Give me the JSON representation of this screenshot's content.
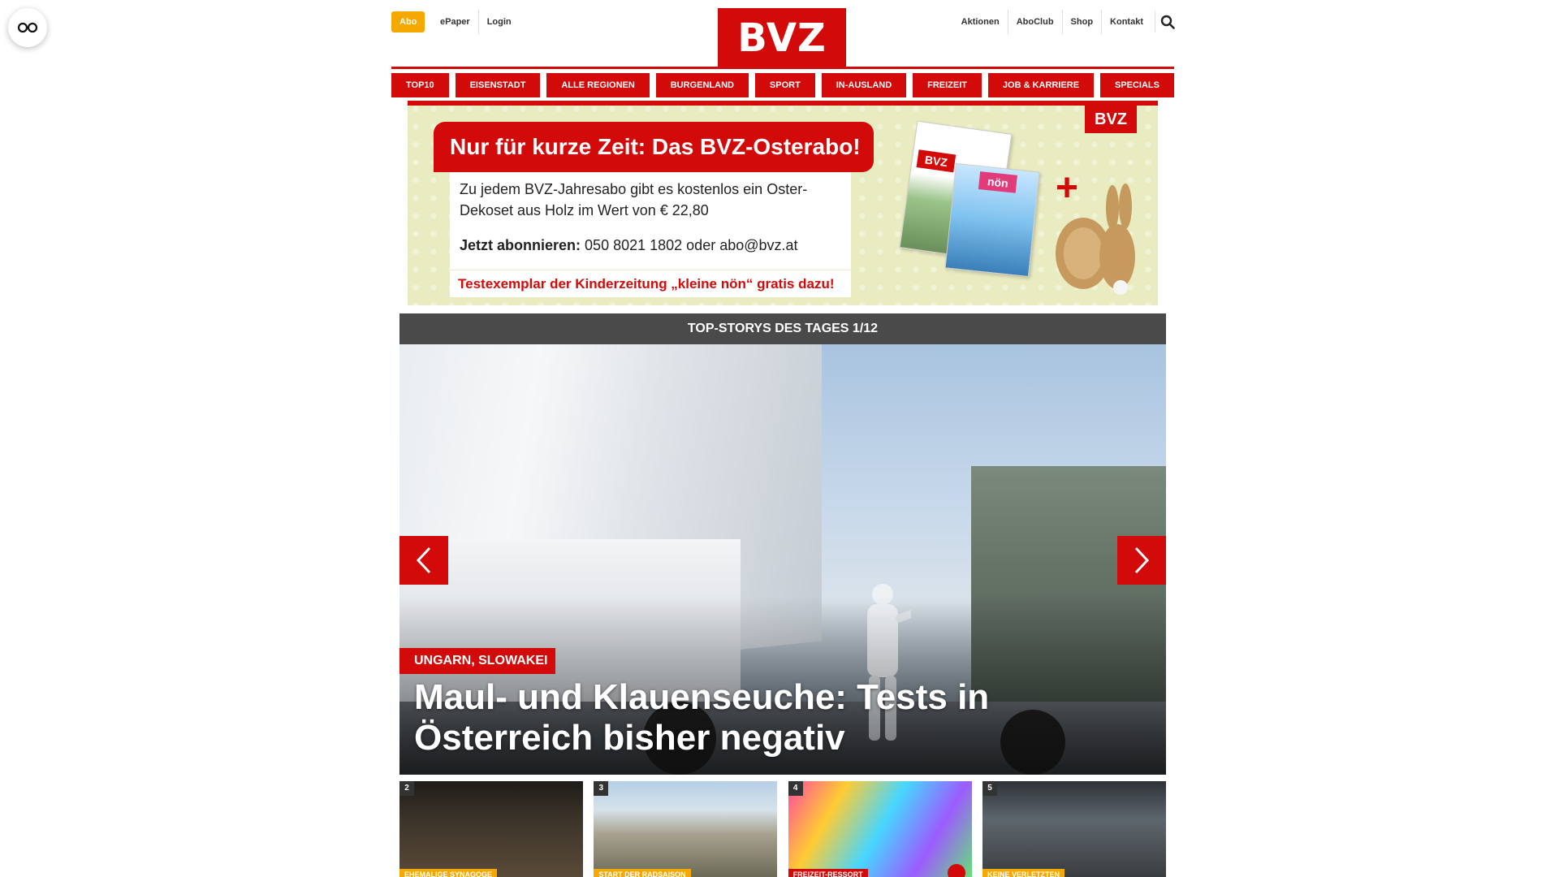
{
  "header": {
    "abo_label": "Abo",
    "left_links": [
      "ePaper",
      "Login"
    ],
    "right_links": [
      "Aktionen",
      "AboClub",
      "Shop",
      "Kontakt"
    ],
    "logo_text": "BVZ"
  },
  "nav": {
    "items": [
      "TOP10",
      "EISENSTADT",
      "ALLE REGIONEN",
      "BURGENLAND",
      "SPORT",
      "IN-AUSLAND",
      "FREIZEIT",
      "JOB & KARRIERE",
      "SPECIALS"
    ]
  },
  "promo": {
    "headline": "Nur für kurze Zeit: Das BVZ-Osterabo!",
    "body": "Zu jedem BVZ-Jahresabo gibt es kostenlos ein Oster-Dekoset aus Holz im Wert von € 22,80",
    "contact_bold": "Jetzt abonnieren:",
    "contact_rest": "050 8021 1802 oder abo@bvz.at",
    "kids_offer": "Testexemplar der Kinderzeitung „kleine nön“ gratis dazu!",
    "logo_text": "BVZ",
    "paper1_logo": "BVZ",
    "paper2_logo": "nön"
  },
  "stories": {
    "bar_label": "TOP-STORYS DES TAGES 1/12",
    "hero": {
      "tag": "UNGARN, SLOWAKEI",
      "title": "Maul- und Klauenseuche: Tests in Österreich bisher negativ"
    },
    "thumbs": [
      {
        "num": "2",
        "tag": "EHEMALIGE SYNAGOGE"
      },
      {
        "num": "3",
        "tag": "START DER RADSAISON"
      },
      {
        "num": "4",
        "tag": "FREIZEIT-RESSORT"
      },
      {
        "num": "5",
        "tag": "KEINE VERLETZTEN"
      }
    ]
  },
  "colors": {
    "brand_red": "#d20a0a",
    "abo_orange": "#f5a800",
    "stories_bar": "#4a4a4a",
    "promo_bg": "#e9ecc0"
  },
  "icons": {
    "accessibility": "glasses-icon",
    "search": "search-icon",
    "prev": "chevron-left-icon",
    "next": "chevron-right-icon"
  }
}
